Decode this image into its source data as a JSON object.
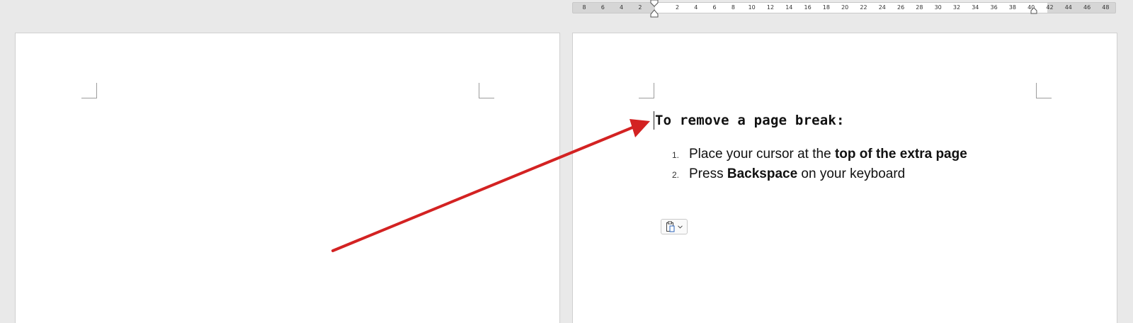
{
  "ruler": {
    "numbers": [
      "8",
      "6",
      "4",
      "2",
      "2",
      "4",
      "6",
      "8",
      "10",
      "12",
      "14",
      "16",
      "18",
      "20",
      "22",
      "24",
      "26",
      "28",
      "30",
      "32",
      "34",
      "36",
      "38",
      "40",
      "42",
      "44",
      "46",
      "48"
    ]
  },
  "document": {
    "heading": "To remove a page break:",
    "steps": [
      {
        "number": "1.",
        "pre": "Place your cursor at the ",
        "bold": "top of the extra page",
        "post": ""
      },
      {
        "number": "2.",
        "pre": "Press ",
        "bold": "Backspace",
        "post": " on your keyboard"
      }
    ]
  },
  "paste_options": {
    "icon": "clipboard-icon",
    "dropdown_icon": "chevron-down-icon"
  },
  "annotation": {
    "arrow_color": "#d32222"
  }
}
